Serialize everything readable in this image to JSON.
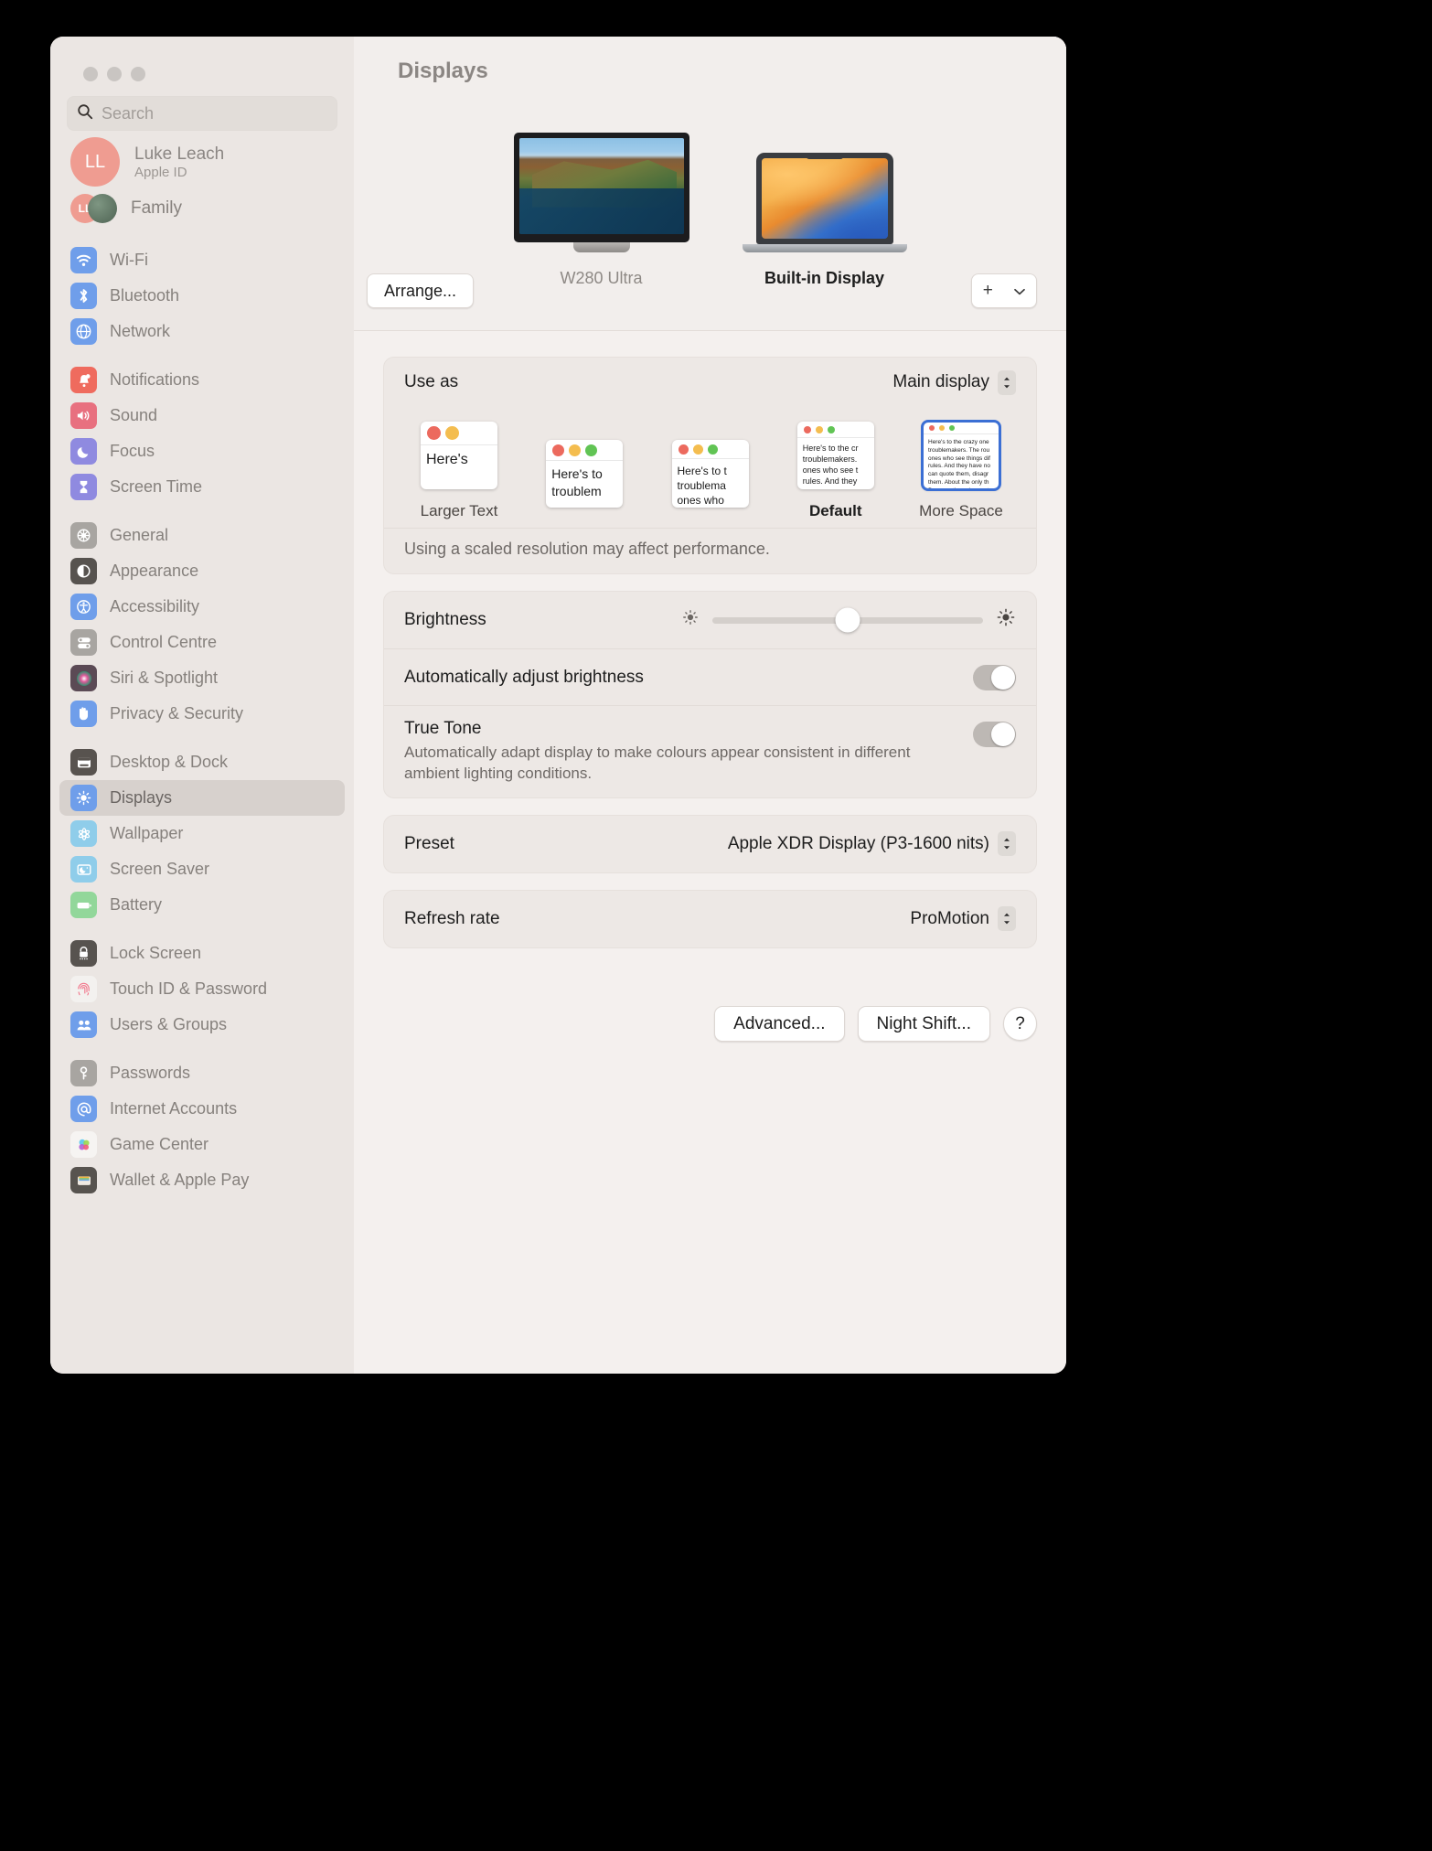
{
  "window": {
    "title": "Displays"
  },
  "sidebar": {
    "search": {
      "placeholder": "Search",
      "icon": "search-icon"
    },
    "account": {
      "initials": "LL",
      "name": "Luke Leach",
      "subtitle": "Apple ID"
    },
    "family": {
      "label": "Family",
      "initials": "LL"
    },
    "groups": [
      {
        "items": [
          {
            "label": "Wi-Fi",
            "icon": "wifi-icon",
            "color": "#6f9eea"
          },
          {
            "label": "Bluetooth",
            "icon": "bluetooth-icon",
            "color": "#6f9eea"
          },
          {
            "label": "Network",
            "icon": "globe-icon",
            "color": "#6f9eea"
          }
        ]
      },
      {
        "items": [
          {
            "label": "Notifications",
            "icon": "bell-icon",
            "color": "#ef6b5e"
          },
          {
            "label": "Sound",
            "icon": "speaker-icon",
            "color": "#e8707f"
          },
          {
            "label": "Focus",
            "icon": "moon-icon",
            "color": "#8f8ae0"
          },
          {
            "label": "Screen Time",
            "icon": "hourglass-icon",
            "color": "#8f8ae0"
          }
        ]
      },
      {
        "items": [
          {
            "label": "General",
            "icon": "gear-icon",
            "color": "#a8a5a1"
          },
          {
            "label": "Appearance",
            "icon": "contrast-icon",
            "color": "#57534f"
          },
          {
            "label": "Accessibility",
            "icon": "accessibility-icon",
            "color": "#6f9eea"
          },
          {
            "label": "Control Centre",
            "icon": "control-centre-icon",
            "color": "#a8a5a1"
          },
          {
            "label": "Siri & Spotlight",
            "icon": "siri-icon",
            "color": "#5b4a55"
          },
          {
            "label": "Privacy & Security",
            "icon": "hand-icon",
            "color": "#6f9eea"
          }
        ]
      },
      {
        "items": [
          {
            "label": "Desktop & Dock",
            "icon": "desktop-dock-icon",
            "color": "#58534f"
          },
          {
            "label": "Displays",
            "icon": "brightness-icon",
            "color": "#6f9eea",
            "selected": true
          },
          {
            "label": "Wallpaper",
            "icon": "wallpaper-icon",
            "color": "#8fcdea"
          },
          {
            "label": "Screen Saver",
            "icon": "screen-saver-icon",
            "color": "#8fcdea"
          },
          {
            "label": "Battery",
            "icon": "battery-icon",
            "color": "#92d79a"
          }
        ]
      },
      {
        "items": [
          {
            "label": "Lock Screen",
            "icon": "lock-icon",
            "color": "#57534f"
          },
          {
            "label": "Touch ID & Password",
            "icon": "fingerprint-icon",
            "color": "#f3f1ef"
          },
          {
            "label": "Users & Groups",
            "icon": "users-icon",
            "color": "#6f9eea"
          }
        ]
      },
      {
        "items": [
          {
            "label": "Passwords",
            "icon": "key-icon",
            "color": "#a8a5a1"
          },
          {
            "label": "Internet Accounts",
            "icon": "at-icon",
            "color": "#6f9eea"
          },
          {
            "label": "Game Center",
            "icon": "game-center-icon",
            "color": "#f6f4f2"
          },
          {
            "label": "Wallet & Apple Pay",
            "icon": "wallet-icon",
            "color": "#57534f"
          }
        ]
      }
    ]
  },
  "main": {
    "title": "Displays",
    "displays": [
      {
        "name": "W280 Ultra",
        "type": "external-monitor",
        "active": false
      },
      {
        "name": "Built-in Display",
        "type": "laptop",
        "active": true
      }
    ],
    "arrange_button": "Arrange...",
    "add_button": {
      "plus": "+",
      "chevron": "chevron-down-icon"
    },
    "use_as": {
      "label": "Use as",
      "value": "Main display"
    },
    "resolutions": [
      {
        "label": "Larger Text",
        "selected": false,
        "dots": 2,
        "text": "Here's",
        "size": "large"
      },
      {
        "label": "",
        "selected": false,
        "dots": 3,
        "text": "Here's to troublem",
        "size": "medium-large"
      },
      {
        "label": "",
        "selected": false,
        "dots": 3,
        "text": "Here's to t troublema ones who",
        "size": "medium"
      },
      {
        "label": "Default",
        "selected": false,
        "dots": 3,
        "text": "Here's to the cr troublemakers. ones who see t rules. And they",
        "size": "small"
      },
      {
        "label": "More Space",
        "selected": true,
        "dots": 3,
        "text": "Here's to the crazy one troublemakers. The rou ones who see things dif rules. And they have no can quote them, disagr them. About the only th Because they change t",
        "size": "tiny"
      }
    ],
    "scaled_note": "Using a scaled resolution may affect performance.",
    "brightness": {
      "label": "Brightness",
      "value": 50
    },
    "auto_brightness": {
      "label": "Automatically adjust brightness",
      "on": true
    },
    "true_tone": {
      "label": "True Tone",
      "description": "Automatically adapt display to make colours appear consistent in different ambient lighting conditions.",
      "on": true
    },
    "preset": {
      "label": "Preset",
      "value": "Apple XDR Display (P3-1600 nits)"
    },
    "refresh_rate": {
      "label": "Refresh rate",
      "value": "ProMotion"
    },
    "footer_buttons": {
      "advanced": "Advanced...",
      "night_shift": "Night Shift...",
      "help": "?"
    }
  },
  "colors": {
    "accent": "#3b6fd4",
    "sidebar_bg": "#ebe6e3",
    "main_bg": "#f4f0ee"
  }
}
